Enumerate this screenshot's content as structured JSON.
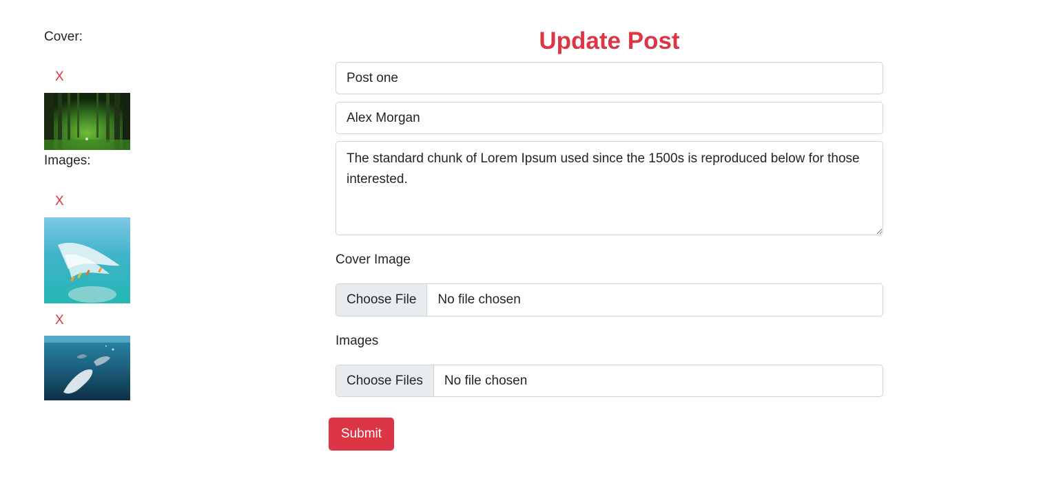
{
  "sidebar": {
    "cover_label": "Cover:",
    "images_label": "Images:",
    "remove_label": "X",
    "cover_image": {
      "icon": "forest-photo"
    },
    "images": [
      {
        "icon": "surfers-photo"
      },
      {
        "icon": "dolphins-photo"
      }
    ]
  },
  "form": {
    "title": "Update Post",
    "title_value": "Post one",
    "author_value": "Alex Morgan",
    "body_value": "The standard chunk of Lorem Ipsum used since the 1500s is reproduced below for those interested.",
    "cover_image_label": "Cover Image",
    "cover_file_button": "Choose File",
    "cover_file_status": "No file chosen",
    "images_label": "Images",
    "images_file_button": "Choose Files",
    "images_file_status": "No file chosen",
    "submit_label": "Submit"
  },
  "colors": {
    "accent": "#dc3545",
    "border": "#ced4da",
    "file_button_bg": "#e9ecef",
    "text": "#212529"
  }
}
